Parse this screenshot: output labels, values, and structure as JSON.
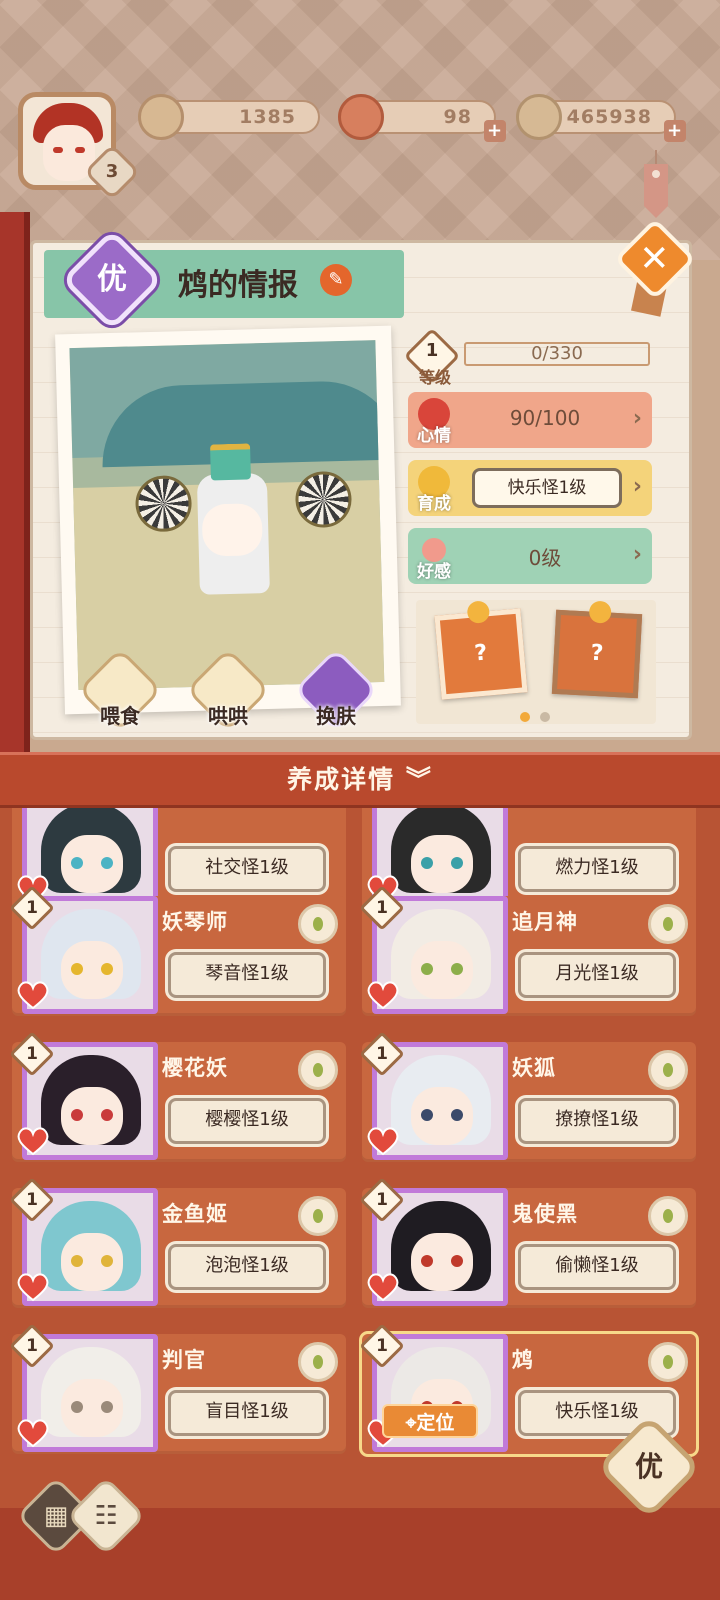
{
  "hud": {
    "avatar_level": "3",
    "resources": [
      {
        "name": "pine",
        "value": "1385",
        "icon": "pine-leaf-icon",
        "has_plus": false
      },
      {
        "name": "tickets",
        "value": "98",
        "icon": "nine-tail-ticket-icon",
        "has_plus": true
      },
      {
        "name": "coins",
        "value": "465938",
        "icon": "coin-icon",
        "has_plus": true
      }
    ]
  },
  "info_panel": {
    "rank_badge": "优",
    "title": "鸩的情报",
    "actions": [
      {
        "label": "喂食",
        "icon": "bowl-icon"
      },
      {
        "label": "哄哄",
        "icon": "milk-carton-icon"
      },
      {
        "label": "换肤",
        "icon": "skin-icon"
      }
    ],
    "stats": {
      "level": {
        "badge": "1",
        "label": "等级",
        "value": "0/330"
      },
      "mood": {
        "label": "心情",
        "value": "90/100"
      },
      "growth": {
        "label": "育成",
        "value": "快乐怪1级"
      },
      "affinity": {
        "label": "好感",
        "value": "0级"
      }
    },
    "item_cards": [
      "?",
      "?"
    ]
  },
  "details_bar": {
    "label": "养成详情",
    "icon": "double-chevron-down-icon"
  },
  "cards": [
    {
      "name": "",
      "level": "",
      "tag": "社交怪1级",
      "hair": "#2d3a40",
      "eye": "#4bb3c4"
    },
    {
      "name": "",
      "level": "",
      "tag": "燃力怪1级",
      "hair": "#2a2a2a",
      "eye": "#3aa0a8"
    },
    {
      "name": "妖琴师",
      "level": "1",
      "tag": "琴音怪1级",
      "hair": "#dfe6ef",
      "eye": "#e5b62e"
    },
    {
      "name": "追月神",
      "level": "1",
      "tag": "月光怪1级",
      "hair": "#f2ece4",
      "eye": "#8cae4a"
    },
    {
      "name": "樱花妖",
      "level": "1",
      "tag": "樱樱怪1级",
      "hair": "#2a1f2a",
      "eye": "#c93b3b"
    },
    {
      "name": "妖狐",
      "level": "1",
      "tag": "撩撩怪1级",
      "hair": "#e8ecf1",
      "eye": "#3b4a6a"
    },
    {
      "name": "金鱼姬",
      "level": "1",
      "tag": "泡泡怪1级",
      "hair": "#7fc7cf",
      "eye": "#e0b43a"
    },
    {
      "name": "鬼使黑",
      "level": "1",
      "tag": "偷懒怪1级",
      "hair": "#1f1c22",
      "eye": "#c0392b"
    },
    {
      "name": "判官",
      "level": "1",
      "tag": "盲目怪1级",
      "hair": "#f1eee9",
      "eye": "#9a8a7a"
    },
    {
      "name": "鸩",
      "level": "1",
      "tag": "快乐怪1级",
      "hair": "#ece9e6",
      "eye": "#c0392b"
    }
  ],
  "locate_label": "定位",
  "you_label": "优",
  "view_buttons": [
    {
      "name": "grid-view-button",
      "glyph": "▦"
    },
    {
      "name": "list-view-button",
      "glyph": "☷"
    }
  ]
}
